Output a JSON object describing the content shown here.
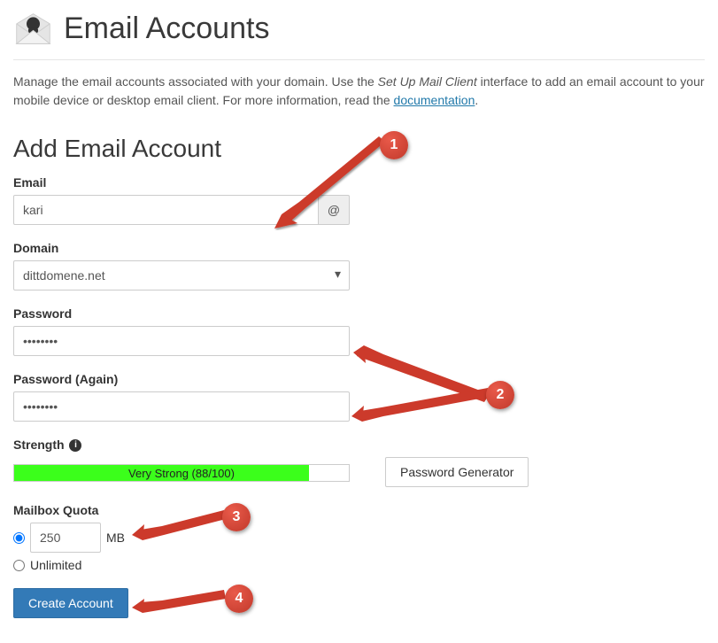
{
  "header": {
    "title": "Email Accounts"
  },
  "intro": {
    "prefix": "Manage the email accounts associated with your domain. Use the ",
    "em": "Set Up Mail Client",
    "mid": " interface to add an email account to your mobile device or desktop email client. For more information, read the ",
    "link": "documentation",
    "suffix": "."
  },
  "form": {
    "section_title": "Add Email Account",
    "email_label": "Email",
    "email_value": "kari",
    "at_symbol": "@",
    "domain_label": "Domain",
    "domain_value": "dittdomene.net",
    "password_label": "Password",
    "password_value": "........",
    "password_again_label": "Password (Again)",
    "password_again_value": "........",
    "strength_label": "Strength",
    "strength_text": "Very Strong (88/100)",
    "strength_percent": 88,
    "pw_generator_label": "Password Generator",
    "quota_label": "Mailbox Quota",
    "quota_value": "250",
    "quota_unit": "MB",
    "quota_unlimited": "Unlimited",
    "submit_label": "Create Account"
  },
  "annotations": {
    "c1": "1",
    "c2": "2",
    "c3": "3",
    "c4": "4"
  },
  "colors": {
    "link": "#2179aa",
    "primary": "#337ab7",
    "strength_fill": "#3bff1b",
    "annotation": "#cc3a2b"
  }
}
